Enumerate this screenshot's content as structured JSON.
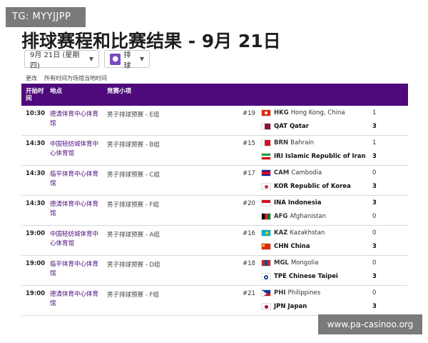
{
  "watermark": {
    "tag": "TG: MYYJJPP",
    "url": "www.pa-casinoo.org"
  },
  "page": {
    "title": "排球赛程和比赛结果 - 9月 21日"
  },
  "controls": {
    "date_label": "9月 21日 (星期四)",
    "sport_label": "排球",
    "sport_icon": "volleyball-icon"
  },
  "subnote": {
    "change": "更改",
    "timezone_note": "所有时间为场馆当地时间"
  },
  "table": {
    "headers": {
      "time": "开始时间",
      "venue": "地点",
      "event": "竞赛小项"
    },
    "rows": [
      {
        "time": "10:30",
        "venue": "德清体育中心体育馆",
        "event": "男子排球预赛 - E组",
        "num": "#19",
        "team1": {
          "code": "HKG",
          "name": "Hong Kong, China",
          "score": "1",
          "flag": "hkg"
        },
        "team2": {
          "code": "QAT",
          "name": "Qatar",
          "score": "3",
          "flag": "qat"
        },
        "winner": 2
      },
      {
        "time": "14:30",
        "venue": "中国轻纺城体育中心体育馆",
        "event": "男子排球预赛 - B组",
        "num": "#15",
        "team1": {
          "code": "BRN",
          "name": "Bahrain",
          "score": "1",
          "flag": "brn"
        },
        "team2": {
          "code": "IRI",
          "name": "Islamic Republic of Iran",
          "score": "3",
          "flag": "iri"
        },
        "winner": 2
      },
      {
        "time": "14:30",
        "venue": "临平体育中心体育馆",
        "event": "男子排球预赛 - C组",
        "num": "#17",
        "team1": {
          "code": "CAM",
          "name": "Cambodia",
          "score": "0",
          "flag": "cam"
        },
        "team2": {
          "code": "KOR",
          "name": "Republic of Korea",
          "score": "3",
          "flag": "kor"
        },
        "winner": 2
      },
      {
        "time": "14:30",
        "venue": "德清体育中心体育馆",
        "event": "男子排球预赛 - F组",
        "num": "#20",
        "team1": {
          "code": "INA",
          "name": "Indonesia",
          "score": "3",
          "flag": "ina"
        },
        "team2": {
          "code": "AFG",
          "name": "Afghanistan",
          "score": "0",
          "flag": "afg"
        },
        "winner": 1
      },
      {
        "time": "19:00",
        "venue": "中国轻纺城体育中心体育馆",
        "event": "男子排球预赛 - A组",
        "num": "#16",
        "team1": {
          "code": "KAZ",
          "name": "Kazakhstan",
          "score": "0",
          "flag": "kaz"
        },
        "team2": {
          "code": "CHN",
          "name": "China",
          "score": "3",
          "flag": "chn"
        },
        "winner": 2
      },
      {
        "time": "19:00",
        "venue": "临平体育中心体育馆",
        "event": "男子排球预赛 - D组",
        "num": "#18",
        "team1": {
          "code": "MGL",
          "name": "Mongolia",
          "score": "0",
          "flag": "mgl"
        },
        "team2": {
          "code": "TPE",
          "name": "Chinese Taipei",
          "score": "3",
          "flag": "tpe"
        },
        "winner": 2
      },
      {
        "time": "19:00",
        "venue": "德清体育中心体育馆",
        "event": "男子排球预赛 - F组",
        "num": "#21",
        "team1": {
          "code": "PHI",
          "name": "Philippines",
          "score": "0",
          "flag": "phi"
        },
        "team2": {
          "code": "JPN",
          "name": "Japan",
          "score": "3",
          "flag": "jpn"
        },
        "winner": 2
      }
    ]
  },
  "colors": {
    "header_bg": "#4e0a7c",
    "venue_link": "#4e0a7c",
    "sport_icon_bg": "#7a4bc1"
  }
}
